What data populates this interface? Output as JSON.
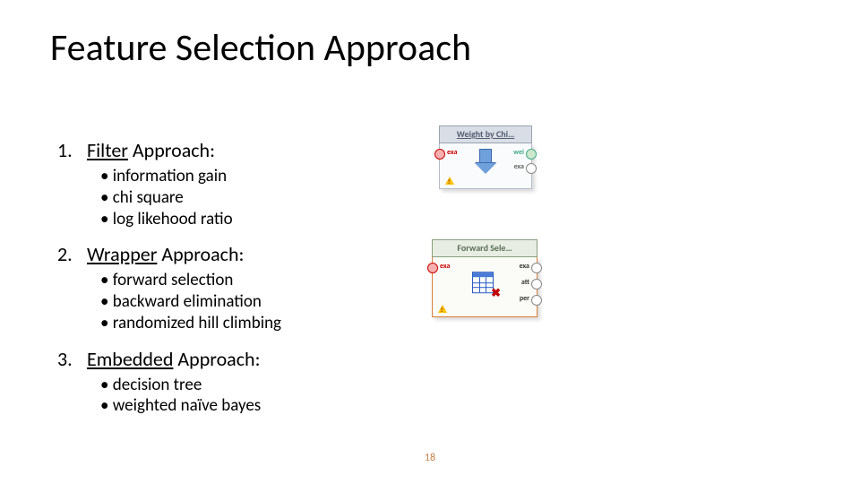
{
  "title": "Feature Selection Approach",
  "approaches": [
    {
      "num": "1.",
      "head_underlined": "Filter",
      "head_rest": " Approach:",
      "items": [
        "information gain",
        "chi square",
        "log likehood ratio"
      ]
    },
    {
      "num": "2.",
      "head_underlined": "Wrapper",
      "head_rest": " Approach:",
      "items": [
        "forward selection",
        "backward elimination",
        "randomized hill climbing"
      ]
    },
    {
      "num": "3.",
      "head_underlined": "Embedded",
      "head_rest": " Approach:",
      "items": [
        "decision tree",
        "weighted naïve bayes"
      ]
    }
  ],
  "op1": {
    "title": "Weight by Chi…",
    "port_left": "exa",
    "port_right_top": "wei",
    "port_right_bot": "exa"
  },
  "op2": {
    "title": "Forward Sele…",
    "port_left": "exa",
    "port_right_top": "exa",
    "port_right_mid": "att",
    "port_right_bot": "per",
    "overlay_x": "✖"
  },
  "page_number": "18"
}
